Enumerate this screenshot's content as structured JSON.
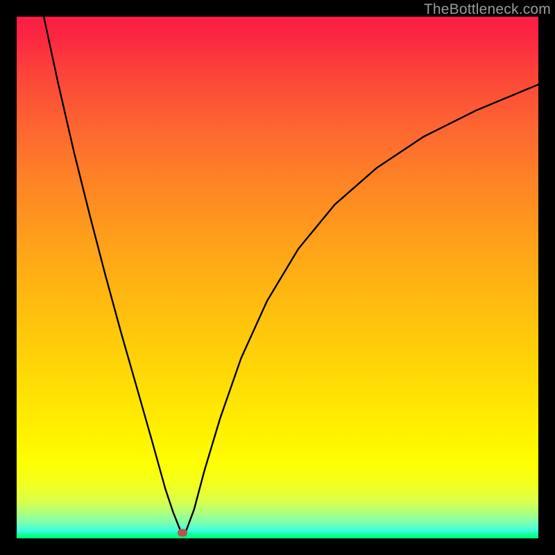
{
  "watermark": "TheBottleneck.com",
  "marker": {
    "x_frac": 0.318,
    "y_frac": 0.989
  },
  "chart_data": {
    "type": "line",
    "title": "",
    "xlabel": "",
    "ylabel": "",
    "xlim": [
      0,
      1
    ],
    "ylim": [
      0,
      1
    ],
    "gradient_stops": [
      {
        "pos": 0.0,
        "color": "#fb1e43"
      },
      {
        "pos": 0.5,
        "color": "#ffb012"
      },
      {
        "pos": 0.8,
        "color": "#fff200"
      },
      {
        "pos": 0.95,
        "color": "#b0ff7c"
      },
      {
        "pos": 1.0,
        "color": "#00ff70"
      }
    ],
    "series": [
      {
        "name": "bottleneck-curve",
        "x": [
          0.052,
          0.08,
          0.11,
          0.14,
          0.17,
          0.2,
          0.23,
          0.26,
          0.285,
          0.3,
          0.312,
          0.318,
          0.325,
          0.34,
          0.36,
          0.39,
          0.43,
          0.48,
          0.54,
          0.61,
          0.69,
          0.78,
          0.88,
          1.0
        ],
        "y": [
          1.0,
          0.87,
          0.74,
          0.62,
          0.505,
          0.395,
          0.29,
          0.185,
          0.095,
          0.05,
          0.02,
          0.005,
          0.015,
          0.055,
          0.13,
          0.23,
          0.345,
          0.455,
          0.555,
          0.64,
          0.71,
          0.77,
          0.82,
          0.87
        ]
      }
    ],
    "marker_point": {
      "x": 0.318,
      "y": 0.011
    }
  }
}
